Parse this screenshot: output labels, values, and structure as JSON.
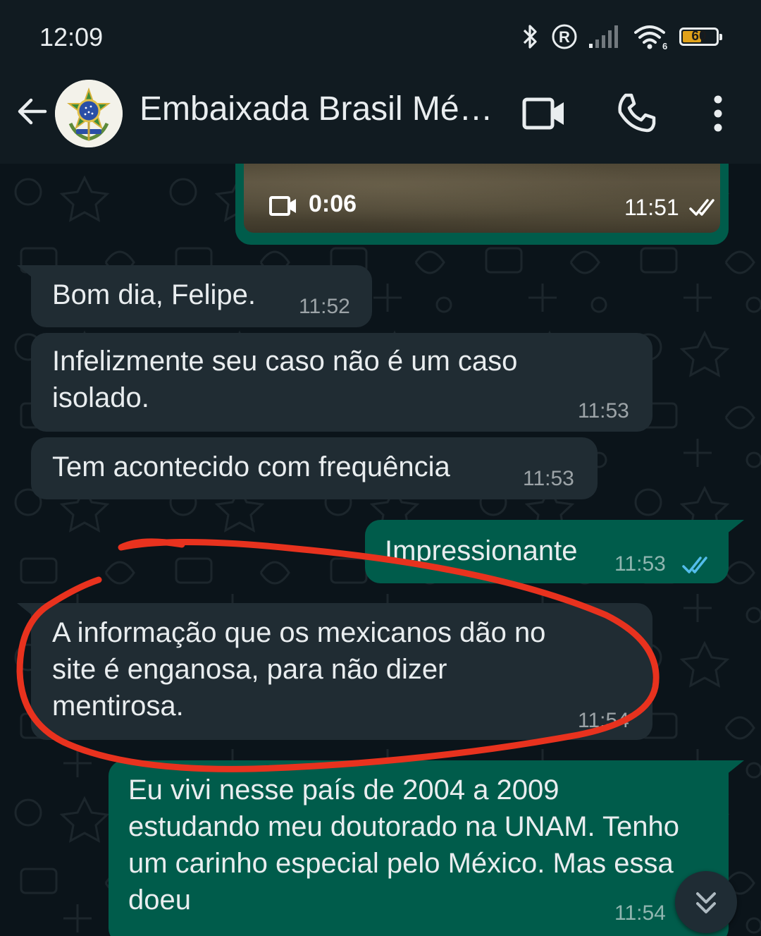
{
  "status_bar": {
    "time": "12:09",
    "battery": "60",
    "battery_level": 0.6,
    "icons": [
      "bluetooth-icon",
      "registered-icon",
      "signal-icon",
      "wifi-icon",
      "battery-icon"
    ]
  },
  "header": {
    "contact_name": "Embaixada Brasil México",
    "icons": [
      "back-arrow-icon",
      "video-call-icon",
      "phone-icon",
      "more-options-icon"
    ]
  },
  "messages": [
    {
      "type": "video",
      "direction": "out",
      "duration": "0:06",
      "time": "11:51",
      "status": "delivered"
    },
    {
      "direction": "in",
      "text": "Bom dia, Felipe.",
      "time": "11:52"
    },
    {
      "direction": "in",
      "text": "Infelizmente seu caso não é um caso isolado.",
      "time": "11:53"
    },
    {
      "direction": "in",
      "text": "Tem acontecido com frequência",
      "time": "11:53"
    },
    {
      "direction": "out",
      "text": "Impressionante",
      "time": "11:53",
      "status": "read"
    },
    {
      "direction": "in",
      "text": "A informação que os mexicanos dão no site é enganosa, para não dizer mentirosa.",
      "time": "11:54"
    },
    {
      "direction": "out",
      "text": "Eu vivi nesse país de 2004 a 2009 estudando meu doutorado na UNAM. Tenho um carinho especial pelo México. Mas essa doeu",
      "time": "11:54"
    }
  ],
  "colors": {
    "incoming_bubble": "#202c33",
    "outgoing_bubble": "#005c4b",
    "read_ticks": "#53bdeb",
    "annotation": "#e8321e"
  }
}
